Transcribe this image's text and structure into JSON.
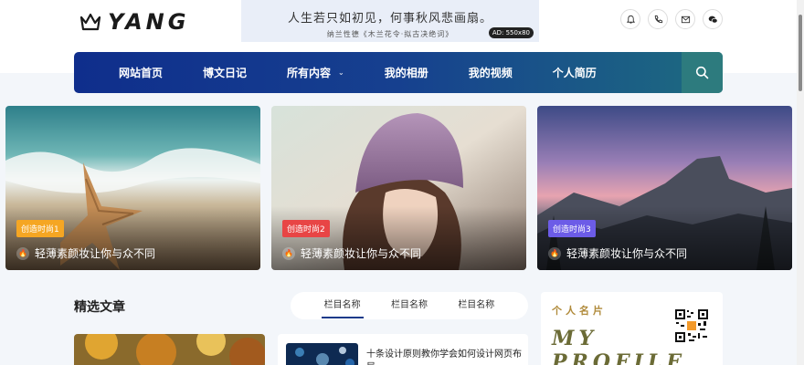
{
  "brand": {
    "name": "YANG"
  },
  "ad": {
    "main": "人生若只如初见，何事秋风悲画扇。",
    "sub": "纳兰性德《木兰花令·拟古决绝词》",
    "tag": "AD: 550x80"
  },
  "tools": [
    {
      "icon": "bell-icon"
    },
    {
      "icon": "phone-icon"
    },
    {
      "icon": "mail-icon"
    },
    {
      "icon": "wechat-icon"
    }
  ],
  "nav": {
    "items": [
      {
        "label": "网站首页"
      },
      {
        "label": "博文日记"
      },
      {
        "label": "所有内容",
        "dropdown": true
      },
      {
        "label": "我的相册"
      },
      {
        "label": "我的视频"
      },
      {
        "label": "个人简历"
      }
    ],
    "search_icon": "search-icon"
  },
  "slides": [
    {
      "badge": "创造时尚1",
      "badge_color": "#f5a623",
      "caption": "轻薄素颜妆让你与众不同"
    },
    {
      "badge": "创造时尚2",
      "badge_color": "#e84545",
      "caption": "轻薄素颜妆让你与众不同"
    },
    {
      "badge": "创造时尚3",
      "badge_color": "#6c5ce7",
      "caption": "轻薄素颜妆让你与众不同"
    }
  ],
  "featured": {
    "title": "精选文章",
    "tabs": [
      {
        "label": "栏目名称",
        "active": true
      },
      {
        "label": "栏目名称",
        "active": false
      },
      {
        "label": "栏目名称",
        "active": false
      }
    ],
    "article_title": "十条设计原则教你学会如何设计网页布局"
  },
  "profile": {
    "label": "个人名片",
    "big_line1": "MY",
    "big_line2": "PROFILE"
  },
  "colors": {
    "nav_start": "#0f2e8c",
    "nav_end": "#1d6b80",
    "accent": "#163a8a"
  }
}
